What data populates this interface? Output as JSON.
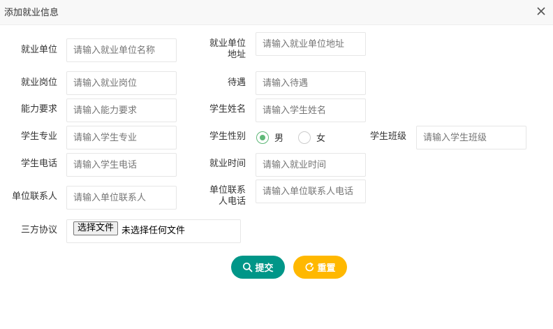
{
  "dialog": {
    "title": "添加就业信息",
    "close_icon": "close-icon"
  },
  "fields": {
    "company": {
      "label": "就业单位",
      "placeholder": "请输入就业单位名称",
      "value": ""
    },
    "company_address": {
      "label": "就业单位地址",
      "placeholder": "请输入就业单位地址",
      "value": ""
    },
    "position": {
      "label": "就业岗位",
      "placeholder": "请输入就业岗位",
      "value": ""
    },
    "salary": {
      "label": "待遇",
      "placeholder": "请输入待遇",
      "value": ""
    },
    "requirement": {
      "label": "能力要求",
      "placeholder": "请输入能力要求",
      "value": ""
    },
    "student_name": {
      "label": "学生姓名",
      "placeholder": "请输入学生姓名",
      "value": ""
    },
    "major": {
      "label": "学生专业",
      "placeholder": "请输入学生专业",
      "value": ""
    },
    "gender": {
      "label": "学生性别",
      "options": [
        "男",
        "女"
      ],
      "selected": "男"
    },
    "student_class": {
      "label": "学生班级",
      "placeholder": "请输入学生班级",
      "value": ""
    },
    "phone": {
      "label": "学生电话",
      "placeholder": "请输入学生电话",
      "value": ""
    },
    "employ_time": {
      "label": "就业时间",
      "placeholder": "请输入就业时间",
      "value": ""
    },
    "contact": {
      "label": "单位联系人",
      "placeholder": "请输入单位联系人",
      "value": ""
    },
    "contact_phone": {
      "label": "单位联系人电话",
      "placeholder": "请输入单位联系人电话",
      "value": ""
    },
    "agreement": {
      "label": "三方协议",
      "button": "选择文件",
      "status": "未选择任何文件"
    }
  },
  "actions": {
    "submit": {
      "label": "提交",
      "icon": "search-icon",
      "color": "#009688"
    },
    "reset": {
      "label": "重置",
      "icon": "refresh-icon",
      "color": "#FFB800"
    }
  },
  "colors": {
    "radio_checked": "#5FB878"
  }
}
